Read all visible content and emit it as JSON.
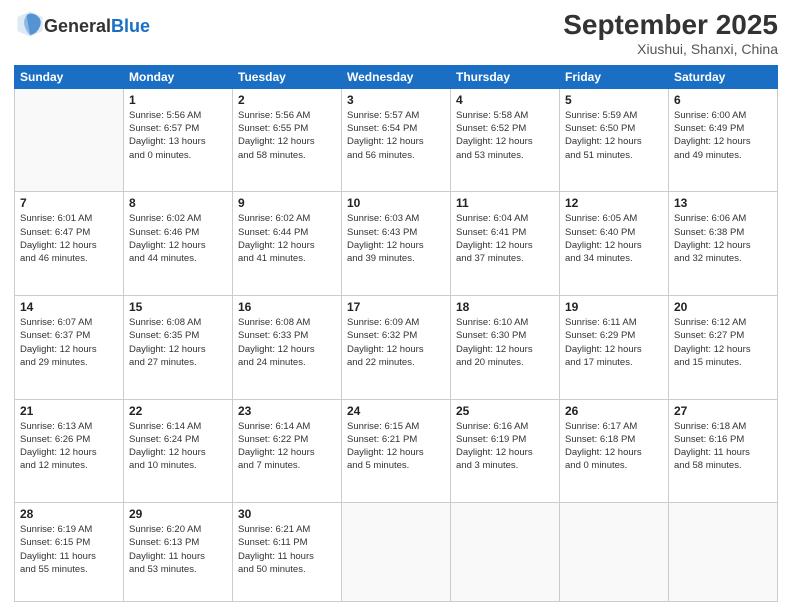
{
  "header": {
    "logo": {
      "general": "General",
      "blue": "Blue"
    },
    "title": "September 2025",
    "subtitle": "Xiushui, Shanxi, China"
  },
  "days_of_week": [
    "Sunday",
    "Monday",
    "Tuesday",
    "Wednesday",
    "Thursday",
    "Friday",
    "Saturday"
  ],
  "weeks": [
    [
      {
        "day": "",
        "info": ""
      },
      {
        "day": "1",
        "info": "Sunrise: 5:56 AM\nSunset: 6:57 PM\nDaylight: 13 hours\nand 0 minutes."
      },
      {
        "day": "2",
        "info": "Sunrise: 5:56 AM\nSunset: 6:55 PM\nDaylight: 12 hours\nand 58 minutes."
      },
      {
        "day": "3",
        "info": "Sunrise: 5:57 AM\nSunset: 6:54 PM\nDaylight: 12 hours\nand 56 minutes."
      },
      {
        "day": "4",
        "info": "Sunrise: 5:58 AM\nSunset: 6:52 PM\nDaylight: 12 hours\nand 53 minutes."
      },
      {
        "day": "5",
        "info": "Sunrise: 5:59 AM\nSunset: 6:50 PM\nDaylight: 12 hours\nand 51 minutes."
      },
      {
        "day": "6",
        "info": "Sunrise: 6:00 AM\nSunset: 6:49 PM\nDaylight: 12 hours\nand 49 minutes."
      }
    ],
    [
      {
        "day": "7",
        "info": "Sunrise: 6:01 AM\nSunset: 6:47 PM\nDaylight: 12 hours\nand 46 minutes."
      },
      {
        "day": "8",
        "info": "Sunrise: 6:02 AM\nSunset: 6:46 PM\nDaylight: 12 hours\nand 44 minutes."
      },
      {
        "day": "9",
        "info": "Sunrise: 6:02 AM\nSunset: 6:44 PM\nDaylight: 12 hours\nand 41 minutes."
      },
      {
        "day": "10",
        "info": "Sunrise: 6:03 AM\nSunset: 6:43 PM\nDaylight: 12 hours\nand 39 minutes."
      },
      {
        "day": "11",
        "info": "Sunrise: 6:04 AM\nSunset: 6:41 PM\nDaylight: 12 hours\nand 37 minutes."
      },
      {
        "day": "12",
        "info": "Sunrise: 6:05 AM\nSunset: 6:40 PM\nDaylight: 12 hours\nand 34 minutes."
      },
      {
        "day": "13",
        "info": "Sunrise: 6:06 AM\nSunset: 6:38 PM\nDaylight: 12 hours\nand 32 minutes."
      }
    ],
    [
      {
        "day": "14",
        "info": "Sunrise: 6:07 AM\nSunset: 6:37 PM\nDaylight: 12 hours\nand 29 minutes."
      },
      {
        "day": "15",
        "info": "Sunrise: 6:08 AM\nSunset: 6:35 PM\nDaylight: 12 hours\nand 27 minutes."
      },
      {
        "day": "16",
        "info": "Sunrise: 6:08 AM\nSunset: 6:33 PM\nDaylight: 12 hours\nand 24 minutes."
      },
      {
        "day": "17",
        "info": "Sunrise: 6:09 AM\nSunset: 6:32 PM\nDaylight: 12 hours\nand 22 minutes."
      },
      {
        "day": "18",
        "info": "Sunrise: 6:10 AM\nSunset: 6:30 PM\nDaylight: 12 hours\nand 20 minutes."
      },
      {
        "day": "19",
        "info": "Sunrise: 6:11 AM\nSunset: 6:29 PM\nDaylight: 12 hours\nand 17 minutes."
      },
      {
        "day": "20",
        "info": "Sunrise: 6:12 AM\nSunset: 6:27 PM\nDaylight: 12 hours\nand 15 minutes."
      }
    ],
    [
      {
        "day": "21",
        "info": "Sunrise: 6:13 AM\nSunset: 6:26 PM\nDaylight: 12 hours\nand 12 minutes."
      },
      {
        "day": "22",
        "info": "Sunrise: 6:14 AM\nSunset: 6:24 PM\nDaylight: 12 hours\nand 10 minutes."
      },
      {
        "day": "23",
        "info": "Sunrise: 6:14 AM\nSunset: 6:22 PM\nDaylight: 12 hours\nand 7 minutes."
      },
      {
        "day": "24",
        "info": "Sunrise: 6:15 AM\nSunset: 6:21 PM\nDaylight: 12 hours\nand 5 minutes."
      },
      {
        "day": "25",
        "info": "Sunrise: 6:16 AM\nSunset: 6:19 PM\nDaylight: 12 hours\nand 3 minutes."
      },
      {
        "day": "26",
        "info": "Sunrise: 6:17 AM\nSunset: 6:18 PM\nDaylight: 12 hours\nand 0 minutes."
      },
      {
        "day": "27",
        "info": "Sunrise: 6:18 AM\nSunset: 6:16 PM\nDaylight: 11 hours\nand 58 minutes."
      }
    ],
    [
      {
        "day": "28",
        "info": "Sunrise: 6:19 AM\nSunset: 6:15 PM\nDaylight: 11 hours\nand 55 minutes."
      },
      {
        "day": "29",
        "info": "Sunrise: 6:20 AM\nSunset: 6:13 PM\nDaylight: 11 hours\nand 53 minutes."
      },
      {
        "day": "30",
        "info": "Sunrise: 6:21 AM\nSunset: 6:11 PM\nDaylight: 11 hours\nand 50 minutes."
      },
      {
        "day": "",
        "info": ""
      },
      {
        "day": "",
        "info": ""
      },
      {
        "day": "",
        "info": ""
      },
      {
        "day": "",
        "info": ""
      }
    ]
  ]
}
